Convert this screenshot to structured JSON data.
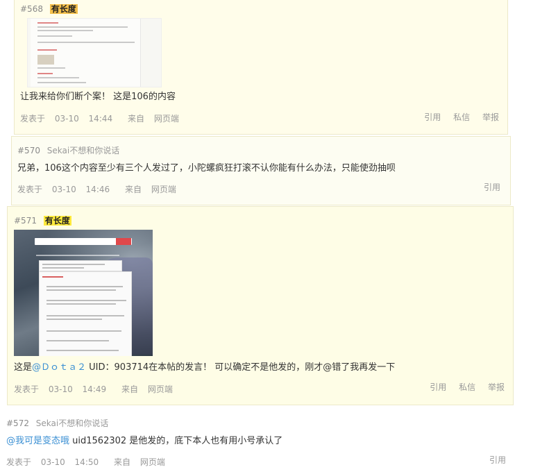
{
  "posts": [
    {
      "number": "#568",
      "author": "有长度",
      "content": "让我来给你们断个案！  这是106的内容",
      "date": "03-10",
      "time": "14:44",
      "source_prefix": "来自",
      "source": "网页端",
      "posted_label": "发表于",
      "actions": [
        "引用",
        "私信",
        "举报"
      ]
    },
    {
      "number": "#570",
      "author": "Sekai不想和你说话",
      "content": "兄弟，106这个内容至少有三个人发过了，小陀螺疯狂打滚不认你能有什么办法，只能使劲抽呗",
      "date": "03-10",
      "time": "14:46",
      "source_prefix": "来自",
      "source": "网页端",
      "posted_label": "发表于",
      "actions": [
        "引用"
      ]
    },
    {
      "number": "#571",
      "author": "有长度",
      "content_prefix": "这是",
      "mention": "@Ｄｏｔａ２",
      "content_suffix": "  UID：903714在本帖的发言！   可以确定不是他发的，刚才@错了我再发一下",
      "date": "03-10",
      "time": "14:49",
      "source_prefix": "来自",
      "source": "网页端",
      "posted_label": "发表于",
      "actions": [
        "引用",
        "私信",
        "举报"
      ]
    },
    {
      "number": "#572",
      "author": "Sekai不想和你说话",
      "mention": "@我可是变态哦",
      "content_suffix": "    uid1562302  是他发的，底下本人也有用小号承认了",
      "date": "03-10",
      "time": "14:50",
      "source_prefix": "来自",
      "source": "网页端",
      "posted_label": "发表于",
      "actions": [
        "引用"
      ]
    }
  ],
  "colors": {
    "author_highlight_orange": "#f5c04b",
    "author_highlight_yellow": "#ffea3c",
    "mention": "#3a8fd3",
    "post_bg": "#fffdea"
  }
}
